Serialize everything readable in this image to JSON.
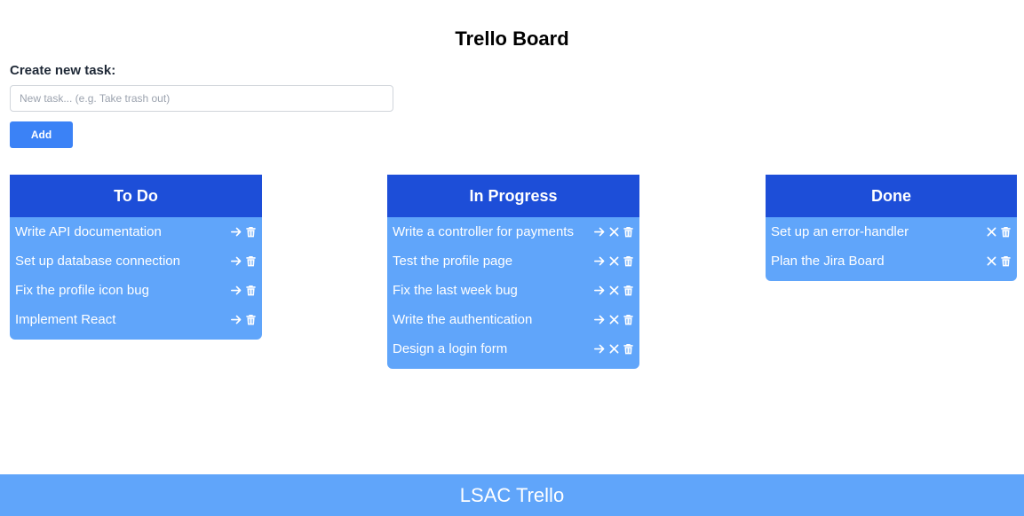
{
  "header": {
    "title": "Trello Board"
  },
  "create": {
    "label": "Create new task:",
    "input_value": "",
    "placeholder": "New task... (e.g. Take trash out)",
    "add_label": "Add"
  },
  "columns": {
    "todo": {
      "title": "To Do",
      "tasks": [
        "Write API documentation",
        "Set up database connection",
        "Fix the profile icon bug",
        "Implement React"
      ],
      "actions": [
        "arrow-right-icon",
        "trash-icon"
      ]
    },
    "in_progress": {
      "title": "In Progress",
      "tasks": [
        "Write a controller for payments",
        "Test the profile page",
        "Fix the last week bug",
        "Write the authentication",
        "Design a login form"
      ],
      "actions": [
        "arrow-right-icon",
        "close-icon",
        "trash-icon"
      ]
    },
    "done": {
      "title": "Done",
      "tasks": [
        "Set up an error-handler",
        "Plan the Jira Board"
      ],
      "actions": [
        "close-icon",
        "trash-icon"
      ]
    }
  },
  "footer": {
    "text": "LSAC Trello"
  },
  "colors": {
    "header_blue": "#1d4ed8",
    "card_blue": "#60a5fa",
    "button_blue": "#3b82f6"
  }
}
